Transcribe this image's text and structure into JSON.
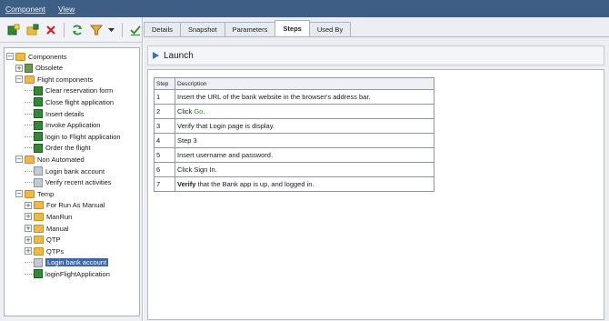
{
  "menubar": {
    "items": [
      "Component",
      "View"
    ]
  },
  "toolbar": {
    "buttons": [
      "add-component-icon",
      "add-folder-icon",
      "delete-icon",
      "refresh-icon",
      "filter-icon",
      "dropdown-icon",
      "check-icon"
    ]
  },
  "tree": {
    "nodes": [
      {
        "label": "Components",
        "type": "folder",
        "level": 0,
        "expander": "−"
      },
      {
        "label": "Obsolete",
        "type": "obsolete",
        "level": 1,
        "expander": "+"
      },
      {
        "label": "Flight components",
        "type": "folder",
        "level": 1,
        "expander": "−"
      },
      {
        "label": "Clear reservation form",
        "type": "component",
        "level": 2
      },
      {
        "label": "Close flight application",
        "type": "component",
        "level": 2
      },
      {
        "label": "Insert details",
        "type": "component",
        "level": 2
      },
      {
        "label": "Invoke Application",
        "type": "component",
        "level": 2
      },
      {
        "label": "login to Flight application",
        "type": "component",
        "level": 2
      },
      {
        "label": "Order the flight",
        "type": "component",
        "level": 2
      },
      {
        "label": "Non Automated",
        "type": "folder",
        "level": 1,
        "expander": "−"
      },
      {
        "label": "Login bank account",
        "type": "manual",
        "level": 2
      },
      {
        "label": "Verify recent activities",
        "type": "manual",
        "level": 2
      },
      {
        "label": "Temp",
        "type": "folder",
        "level": 1,
        "expander": "−"
      },
      {
        "label": "For Run As Manual",
        "type": "folder",
        "level": 2,
        "expander": "+"
      },
      {
        "label": "ManRun",
        "type": "folder",
        "level": 2,
        "expander": "+"
      },
      {
        "label": "Manual",
        "type": "folder",
        "level": 2,
        "expander": "+"
      },
      {
        "label": "QTP",
        "type": "folder",
        "level": 2,
        "expander": "+"
      },
      {
        "label": "QTPs",
        "type": "folder",
        "level": 2,
        "expander": "+"
      },
      {
        "label": "Login bank account",
        "type": "manual",
        "level": 2,
        "selected": true
      },
      {
        "label": "loginFlightApplication",
        "type": "component",
        "level": 2
      }
    ]
  },
  "tabs": [
    {
      "label": "Details",
      "active": false
    },
    {
      "label": "Snapshot",
      "active": false
    },
    {
      "label": "Parameters",
      "active": false
    },
    {
      "label": "Steps",
      "active": true
    },
    {
      "label": "Used By",
      "active": false
    }
  ],
  "launch": {
    "label": "Launch"
  },
  "steps": {
    "headers": {
      "step": "Step",
      "description": "Description"
    },
    "rows": [
      {
        "step": "1",
        "parts": [
          {
            "text": "Insert the URL of the bank website in the browser's address bar.",
            "style": ""
          }
        ]
      },
      {
        "step": "2",
        "parts": [
          {
            "text": "Click ",
            "style": ""
          },
          {
            "text": "Go",
            "style": "go"
          },
          {
            "text": ".",
            "style": ""
          }
        ]
      },
      {
        "step": "3",
        "parts": [
          {
            "text": "Verify that Login page is display.",
            "style": ""
          }
        ]
      },
      {
        "step": "4",
        "parts": [
          {
            "text": "Step 3",
            "style": ""
          }
        ]
      },
      {
        "step": "5",
        "parts": [
          {
            "text": "Insert username and password.",
            "style": ""
          }
        ]
      },
      {
        "step": "6",
        "parts": [
          {
            "text": "Click Sign In.",
            "style": ""
          }
        ]
      },
      {
        "step": "7",
        "parts": [
          {
            "text": "Verify",
            "style": "bold"
          },
          {
            "text": " that the Bank app is up, and logged in.",
            "style": ""
          }
        ]
      }
    ]
  },
  "colors": {
    "menubar": "#3f5e86",
    "selection": "#3d68a8",
    "folder": "#f0b944",
    "component": "#2f8a33",
    "go_text": "#2a8f2a"
  }
}
